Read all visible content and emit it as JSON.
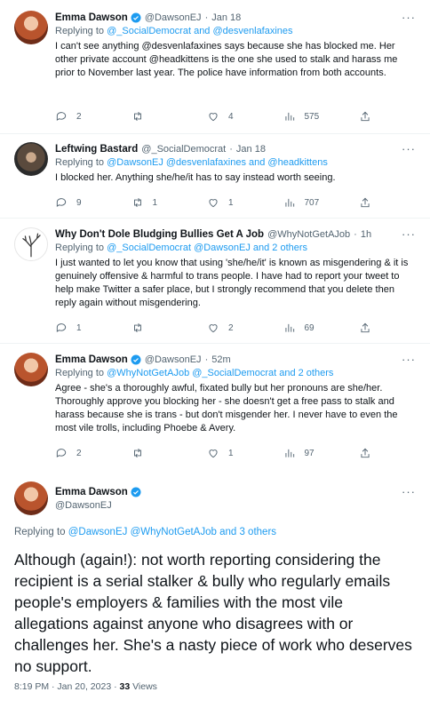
{
  "tweets": [
    {
      "name": "Emma Dawson",
      "handle": "@DawsonEJ",
      "time": "Jan 18",
      "replying_prefix": "Replying to ",
      "replying_to": "@_SocialDemocrat and @desvenlafaxines",
      "text": "I can't see anything @desvenlafaxines says because she has blocked me. Her other private account @headkittens is the one she used to stalk and harass me prior to November last year. The police have information from both accounts.",
      "replies": "2",
      "retweets": "",
      "likes": "4",
      "views": "575"
    },
    {
      "name": "Leftwing Bastard",
      "handle": "@_SocialDemocrat",
      "time": "Jan 18",
      "replying_prefix": "Replying to ",
      "replying_to": "@DawsonEJ @desvenlafaxines and @headkittens",
      "text": "I blocked her. Anything she/he/it has to say instead worth seeing.",
      "replies": "9",
      "retweets": "1",
      "likes": "1",
      "views": "707"
    },
    {
      "name": "Why Don't Dole Bludging Bullies Get A Job",
      "handle": "@WhyNotGetAJob",
      "time": "1h",
      "replying_prefix": "Replying to ",
      "replying_to": "@_SocialDemocrat @DawsonEJ and 2 others",
      "text": "I just wanted to let you know that using 'she/he/it' is known as misgendering & it is genuinely offensive & harmful to trans people. I have had to report your tweet to help make Twitter a safer place, but I strongly recommend that you delete then reply again without misgendering.",
      "replies": "1",
      "retweets": "",
      "likes": "2",
      "views": "69"
    },
    {
      "name": "Emma Dawson",
      "handle": "@DawsonEJ",
      "time": "52m",
      "replying_prefix": "Replying to ",
      "replying_to": "@WhyNotGetAJob @_SocialDemocrat and 2 others",
      "text": "Agree - she's a thoroughly awful, fixated bully but her pronouns are she/her. Thoroughly approve you blocking her - she doesn't get a free pass to stalk and harass because she is trans - but don't misgender her. I never have to even the most vile trolls, including Phoebe & Avery.",
      "replies": "2",
      "retweets": "",
      "likes": "1",
      "views": "97"
    }
  ],
  "main_tweet": {
    "name": "Emma Dawson",
    "handle": "@DawsonEJ",
    "replying_prefix": "Replying to ",
    "replying_to": "@DawsonEJ @WhyNotGetAJob and 3 others",
    "text": "Although (again!): not worth reporting considering the recipient is a serial stalker & bully who regularly emails people's employers & families with the most vile allegations against anyone who disagrees with or challenges her. She's a nasty piece of work who deserves no support.",
    "time": "8:19 PM · Jan 20, 2023 · ",
    "views": "33",
    "views_label": " Views"
  },
  "more_label": "···",
  "colors": {
    "link": "#1d9bf0",
    "verified": "#1d9bf0",
    "muted": "#536471"
  }
}
